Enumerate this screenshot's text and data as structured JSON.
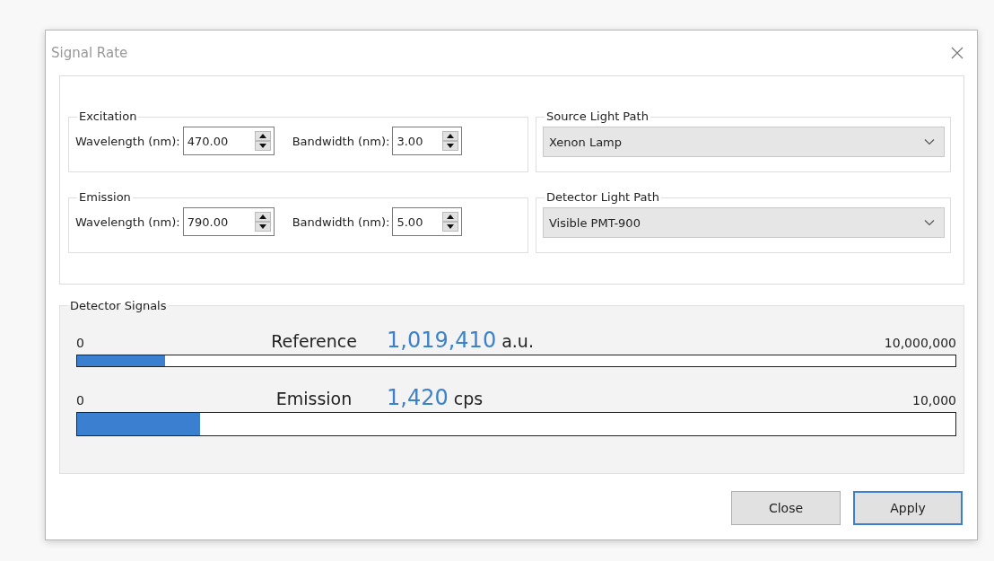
{
  "window": {
    "title": "Signal Rate"
  },
  "monochromator_groups": [
    {
      "title": "Excitation",
      "fields": [
        {
          "label": "Wavelength (nm):",
          "value": "470.00"
        },
        {
          "label": "Bandwidth (nm):",
          "value": "3.00"
        }
      ]
    },
    {
      "title": "Emission",
      "fields": [
        {
          "label": "Wavelength (nm):",
          "value": "790.00"
        },
        {
          "label": "Bandwidth (nm):",
          "value": "5.00"
        }
      ]
    }
  ],
  "light_paths": [
    {
      "title": "Source Light Path",
      "value": "Xenon Lamp"
    },
    {
      "title": "Detector Light Path",
      "value": "Visible PMT-900"
    }
  ],
  "detector_signals": {
    "title": "Detector Signals",
    "signals": [
      {
        "min": "0",
        "name": "Reference",
        "value": "1,019,410",
        "unit": "a.u.",
        "max": "10,000,000",
        "level": 0.1
      },
      {
        "min": "0",
        "name": "Emission",
        "value": "1,420",
        "unit": "cps",
        "max": "10,000",
        "level": 0.14
      }
    ]
  },
  "buttons": [
    {
      "label": "Close",
      "selected": false
    },
    {
      "label": "Apply",
      "selected": true
    }
  ]
}
